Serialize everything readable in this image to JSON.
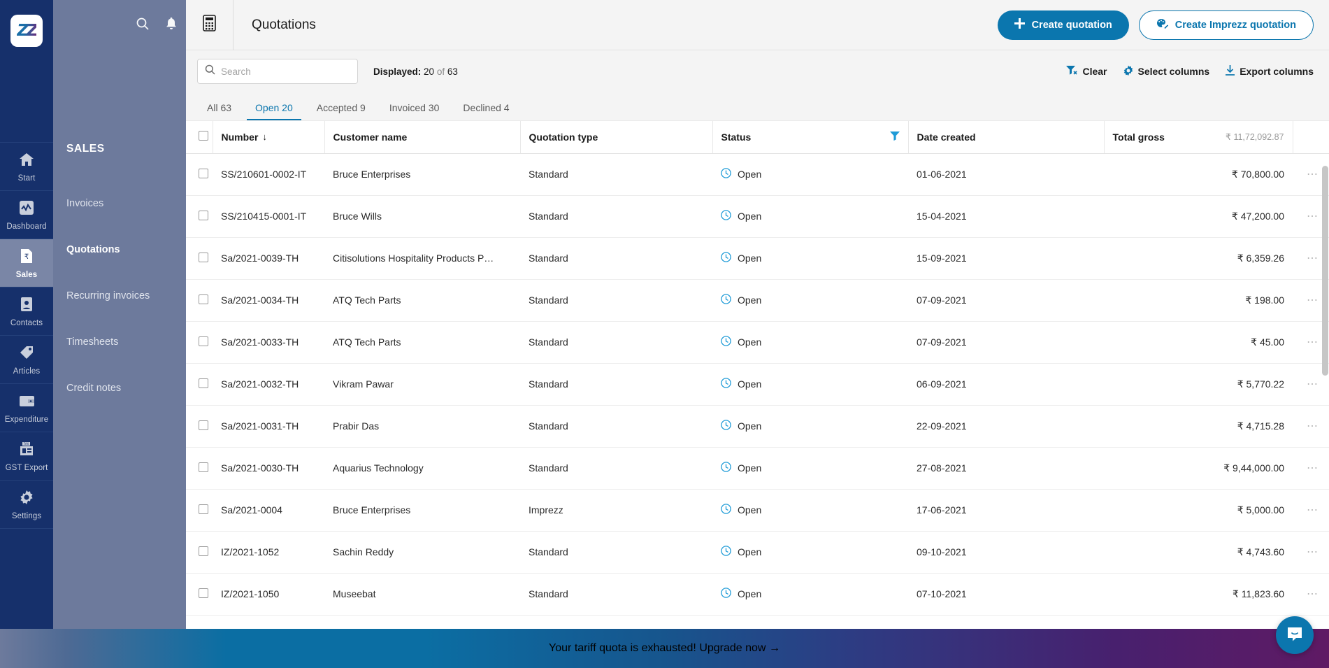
{
  "rail": {
    "logo_text": "ZZ",
    "items": [
      {
        "label": "Start",
        "icon": "home-icon",
        "active": false
      },
      {
        "label": "Dashboard",
        "icon": "dashboard-icon",
        "active": false
      },
      {
        "label": "Sales",
        "icon": "sales-document-icon",
        "active": true
      },
      {
        "label": "Contacts",
        "icon": "contacts-icon",
        "active": false
      },
      {
        "label": "Articles",
        "icon": "tag-icon",
        "active": false
      },
      {
        "label": "Expenditure",
        "icon": "wallet-icon",
        "active": false
      },
      {
        "label": "GST Export",
        "icon": "tax-export-icon",
        "active": false
      },
      {
        "label": "Settings",
        "icon": "gear-icon",
        "active": false
      }
    ],
    "logout_icon": "logout-icon"
  },
  "subnav": {
    "search_icon": "search-icon",
    "bell_icon": "bell-icon",
    "title": "SALES",
    "items": [
      {
        "label": "Invoices",
        "active": false
      },
      {
        "label": "Quotations",
        "active": true
      },
      {
        "label": "Recurring invoices",
        "active": false
      },
      {
        "label": "Timesheets",
        "active": false
      },
      {
        "label": "Credit notes",
        "active": false
      }
    ]
  },
  "topbar": {
    "page_icon": "calculator-icon",
    "title": "Quotations",
    "create_button": "Create quotation",
    "create_button_icon": "plus-icon",
    "imprezz_button": "Create Imprezz quotation",
    "imprezz_button_icon": "palette-icon"
  },
  "toolbar": {
    "search_placeholder": "Search",
    "search_value": "",
    "search_icon": "search-icon",
    "displayed_label": "Displayed:",
    "displayed_count": "20",
    "displayed_of": "of",
    "displayed_total": "63",
    "clear_label": "Clear",
    "clear_icon": "filter-clear-icon",
    "select_columns_label": "Select columns",
    "select_columns_icon": "gear-icon",
    "export_columns_label": "Export columns",
    "export_columns_icon": "download-icon"
  },
  "tabs": [
    {
      "label": "All 63",
      "active": false
    },
    {
      "label": "Open 20",
      "active": true
    },
    {
      "label": "Accepted 9",
      "active": false
    },
    {
      "label": "Invoiced 30",
      "active": false
    },
    {
      "label": "Declined 4",
      "active": false
    }
  ],
  "table": {
    "columns": {
      "number": "Number",
      "number_sort_icon": "arrow-down-icon",
      "customer": "Customer name",
      "type": "Quotation type",
      "status": "Status",
      "status_filter_icon": "filter-icon",
      "date": "Date created",
      "gross": "Total gross",
      "gross_total": "₹ 11,72,092.87"
    },
    "rows": [
      {
        "number": "SS/210601-0002-IT",
        "customer": "Bruce Enterprises",
        "type": "Standard",
        "status": "Open",
        "date": "01-06-2021",
        "gross": "₹ 70,800.00"
      },
      {
        "number": "SS/210415-0001-IT",
        "customer": "Bruce Wills",
        "type": "Standard",
        "status": "Open",
        "date": "15-04-2021",
        "gross": "₹ 47,200.00"
      },
      {
        "number": "Sa/2021-0039-TH",
        "customer": "Citisolutions Hospitality Products P…",
        "type": "Standard",
        "status": "Open",
        "date": "15-09-2021",
        "gross": "₹ 6,359.26"
      },
      {
        "number": "Sa/2021-0034-TH",
        "customer": "ATQ Tech Parts",
        "type": "Standard",
        "status": "Open",
        "date": "07-09-2021",
        "gross": "₹ 198.00"
      },
      {
        "number": "Sa/2021-0033-TH",
        "customer": "ATQ Tech Parts",
        "type": "Standard",
        "status": "Open",
        "date": "07-09-2021",
        "gross": "₹ 45.00"
      },
      {
        "number": "Sa/2021-0032-TH",
        "customer": "Vikram Pawar",
        "type": "Standard",
        "status": "Open",
        "date": "06-09-2021",
        "gross": "₹ 5,770.22"
      },
      {
        "number": "Sa/2021-0031-TH",
        "customer": "Prabir Das",
        "type": "Standard",
        "status": "Open",
        "date": "22-09-2021",
        "gross": "₹ 4,715.28"
      },
      {
        "number": "Sa/2021-0030-TH",
        "customer": "Aquarius Technology",
        "type": "Standard",
        "status": "Open",
        "date": "27-08-2021",
        "gross": "₹ 9,44,000.00"
      },
      {
        "number": "Sa/2021-0004",
        "customer": "Bruce Enterprises",
        "type": "Imprezz",
        "status": "Open",
        "date": "17-06-2021",
        "gross": "₹ 5,000.00"
      },
      {
        "number": "IZ/2021-1052",
        "customer": "Sachin Reddy",
        "type": "Standard",
        "status": "Open",
        "date": "09-10-2021",
        "gross": "₹ 4,743.60"
      },
      {
        "number": "IZ/2021-1050",
        "customer": "Museebat",
        "type": "Standard",
        "status": "Open",
        "date": "07-10-2021",
        "gross": "₹ 11,823.60"
      }
    ],
    "row_menu_icon": "more-options-icon",
    "status_icon": "clock-icon"
  },
  "banner": {
    "message": "Your tariff quota is exhausted!",
    "link": "Upgrade now",
    "arrow_icon": "arrow-right-icon"
  },
  "chat": {
    "icon": "chat-bubble-icon"
  },
  "colors": {
    "accent": "#0b76ae",
    "rail_bg": "#16306b",
    "subnav_bg": "#6d7a9c"
  }
}
